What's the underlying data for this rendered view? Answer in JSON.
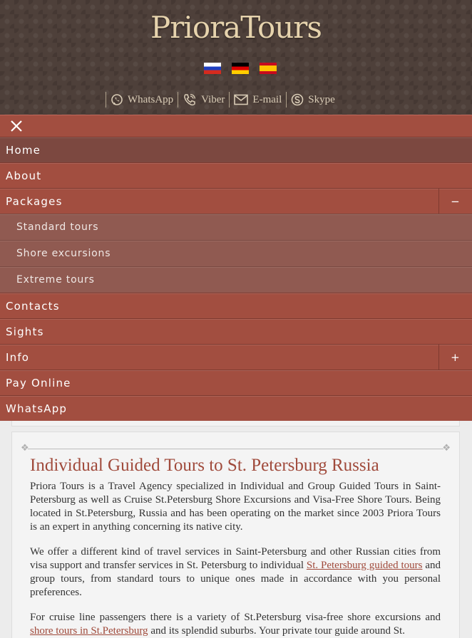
{
  "header": {
    "logo": "PrioraTours",
    "languages": [
      "Russian",
      "German",
      "Spanish"
    ],
    "contacts": [
      {
        "label": "WhatsApp",
        "icon": "whatsapp-icon"
      },
      {
        "label": "Viber",
        "icon": "viber-icon"
      },
      {
        "label": "E-mail",
        "icon": "envelope-icon"
      },
      {
        "label": "Skype",
        "icon": "skype-icon"
      }
    ]
  },
  "menu": {
    "close_icon": "close-icon",
    "items": {
      "home": "Home",
      "about": "About",
      "packages": "Packages",
      "packages_toggle": "−",
      "standard": "Standard tours",
      "shore": "Shore excursions",
      "extreme": "Extreme tours",
      "contacts": "Contacts",
      "sights": "Sights",
      "info": "Info",
      "info_toggle": "+",
      "pay": "Pay Online",
      "whatsapp": "WhatsApp"
    }
  },
  "content": {
    "title": "Individual Guided Tours to St. Petersburg Russia",
    "p1": "Priora Tours is a Travel Agency specialized in Individual and Group Guided Tours in Saint-Petersburg as well as Cruise St.Petersburg Shore Excursions and Visa-Free Shore Tours. Being located in St.Petersburg, Russia and has been operating on the market since 2003 Priora Tours is an expert in anything concerning its native city.",
    "p2_before": "We offer a different kind of travel services in Saint-Petersburg and other Russian cities from visa support and transfer services in St. Petersburg to individual ",
    "p2_link": "St. Petersburg guided tours",
    "p2_after": " and group tours, from standard tours to unique ones made in accordance with you personal preferences.",
    "p3_before": "For cruise line passengers there is a variety of St.Petersburg visa-free shore excursions and ",
    "p3_link": "shore tours in St.Petersburg",
    "p3_after": " and its splendid suburbs. Your private tour guide around St."
  },
  "colors": {
    "menu_bg": "#a24e40",
    "menu_active": "#7c4840",
    "submenu_bg": "#905a51",
    "header_bg": "#4e403a",
    "logo": "#e6d3ad",
    "title": "#a04a3b"
  }
}
